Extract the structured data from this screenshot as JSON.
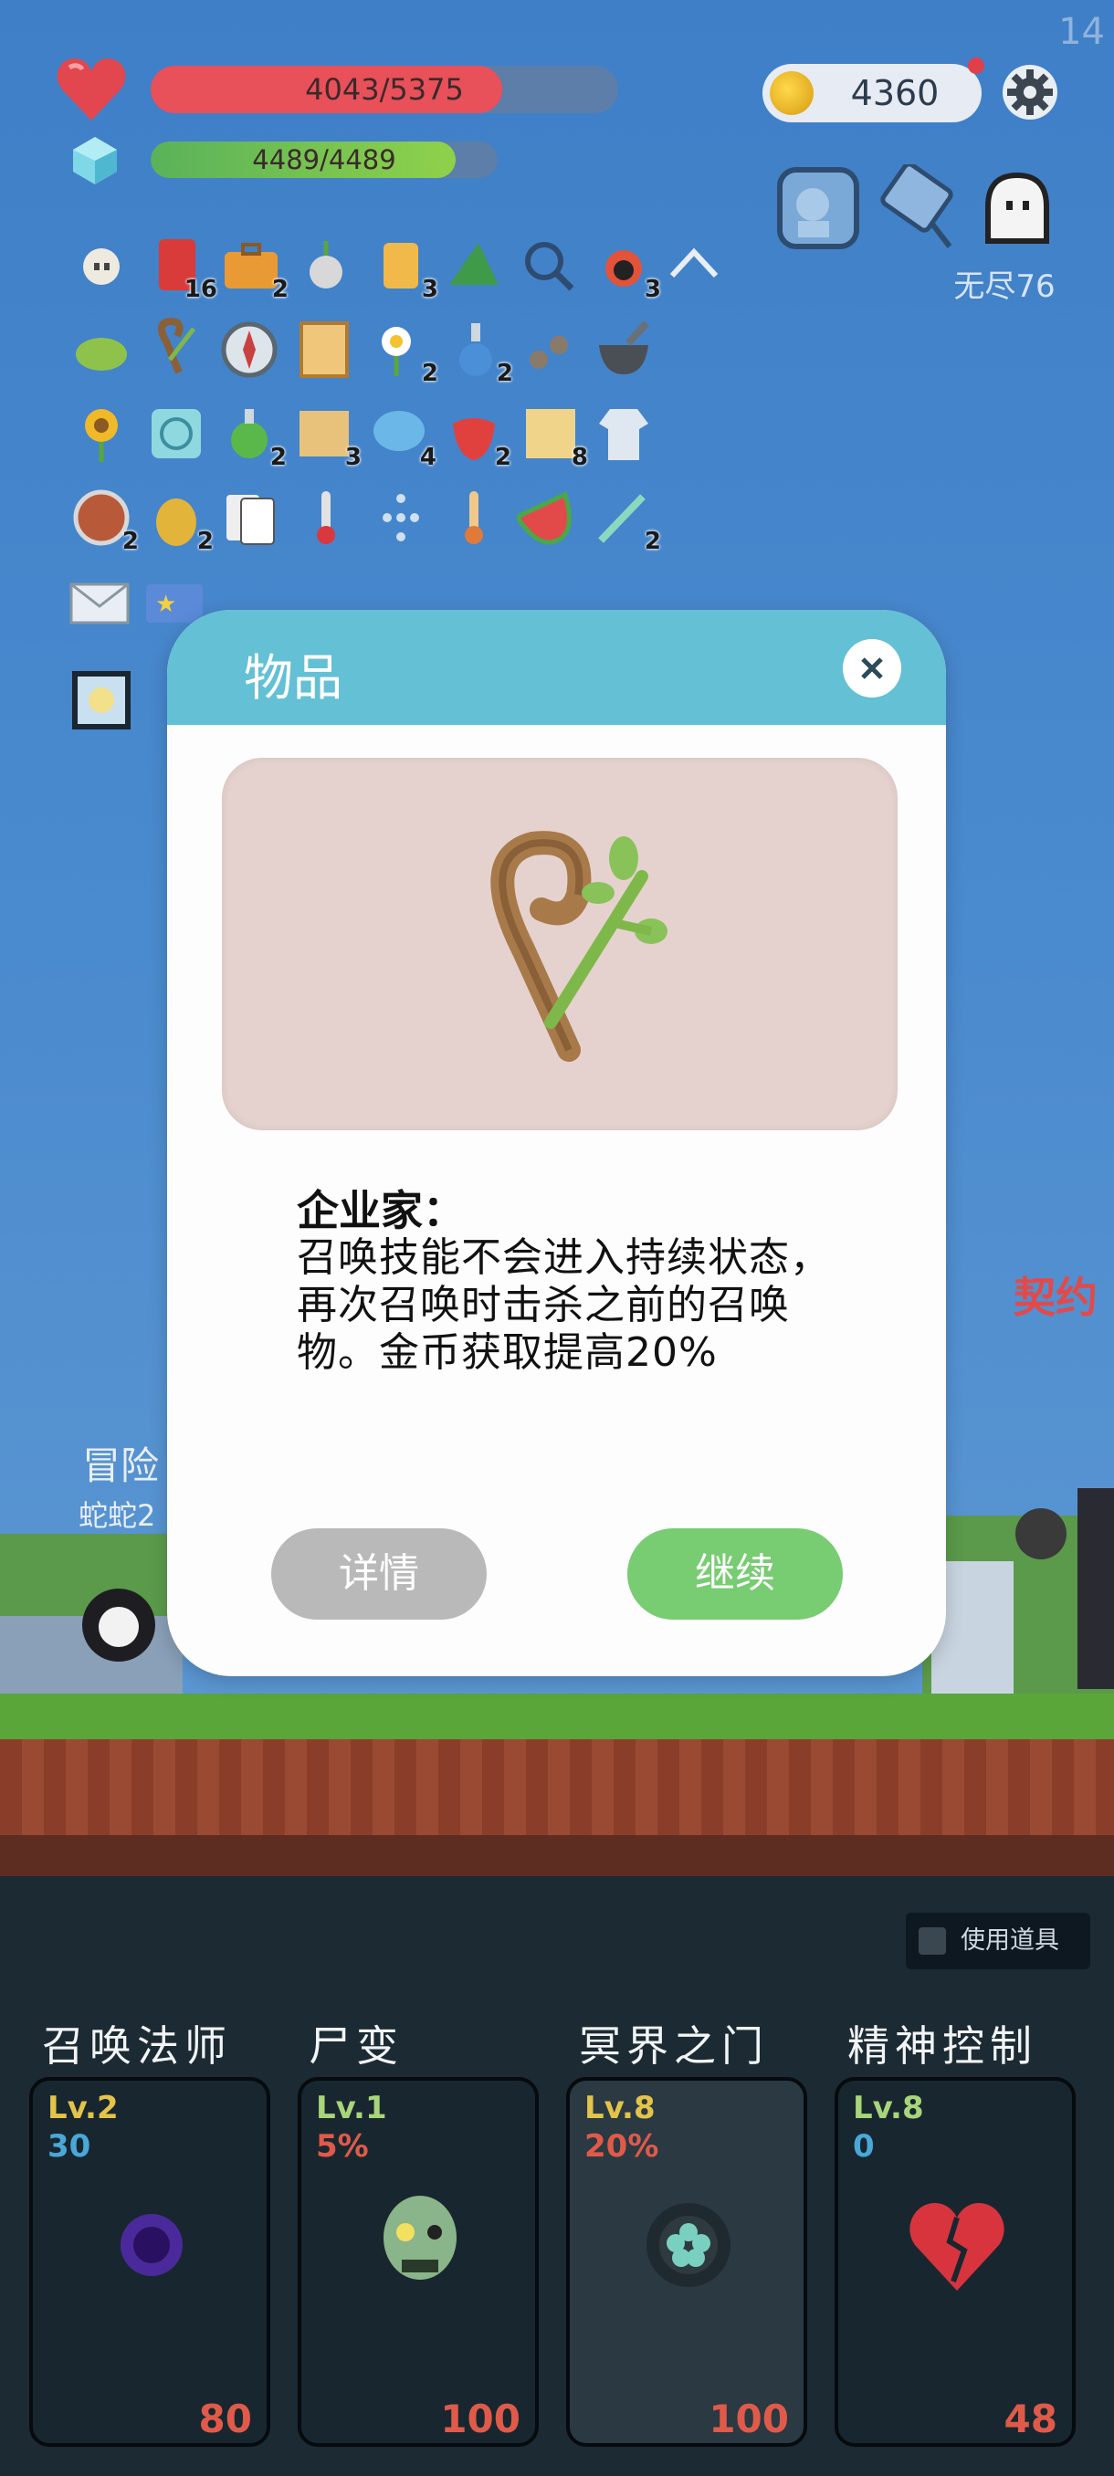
{
  "corner_number": "14",
  "stats": {
    "hp": "4043/5375",
    "hp_fraction": 0.752,
    "mana": "4489/4489",
    "mana_fraction": 1.0,
    "coins": "4360"
  },
  "endless_label": "无尽76",
  "inventory_counts": {
    "card_red": "16",
    "briefcase": "2",
    "scroll": "3",
    "skull_fire": "3",
    "flower_white": "2",
    "potion_blue": "2",
    "potion_green": "2",
    "map": "3",
    "chat": "4",
    "strawberry": "2",
    "map2": "8",
    "shield": "2",
    "pineapple": "2",
    "scalpel": "2"
  },
  "scene_text": {
    "left_title": "冒险",
    "left_sub": "蛇蛇2",
    "right_title": "契约"
  },
  "modal": {
    "title": "物品",
    "item_name": "企业家：",
    "item_desc": "召唤技能不会进入持续状态，再次召唤时击杀之前的召唤物。金币获取提高20%",
    "details_label": "详情",
    "continue_label": "继续"
  },
  "use_item_label": "使用道具",
  "skills": [
    {
      "title": "召唤法师",
      "level": "Lv.2",
      "stat": "30",
      "cost": "80"
    },
    {
      "title": "尸变",
      "level": "Lv.1",
      "stat": "5%",
      "cost": "100"
    },
    {
      "title": "冥界之门",
      "level": "Lv.8",
      "stat": "20%",
      "cost": "100"
    },
    {
      "title": "精神控制",
      "level": "Lv.8",
      "stat": "0",
      "cost": "48"
    }
  ],
  "colors": {
    "hp": "#e8505a",
    "mana": "#6fc24f",
    "modal_header": "#64c0d4",
    "continue": "#78cc72",
    "details": "#b9b9b9"
  }
}
